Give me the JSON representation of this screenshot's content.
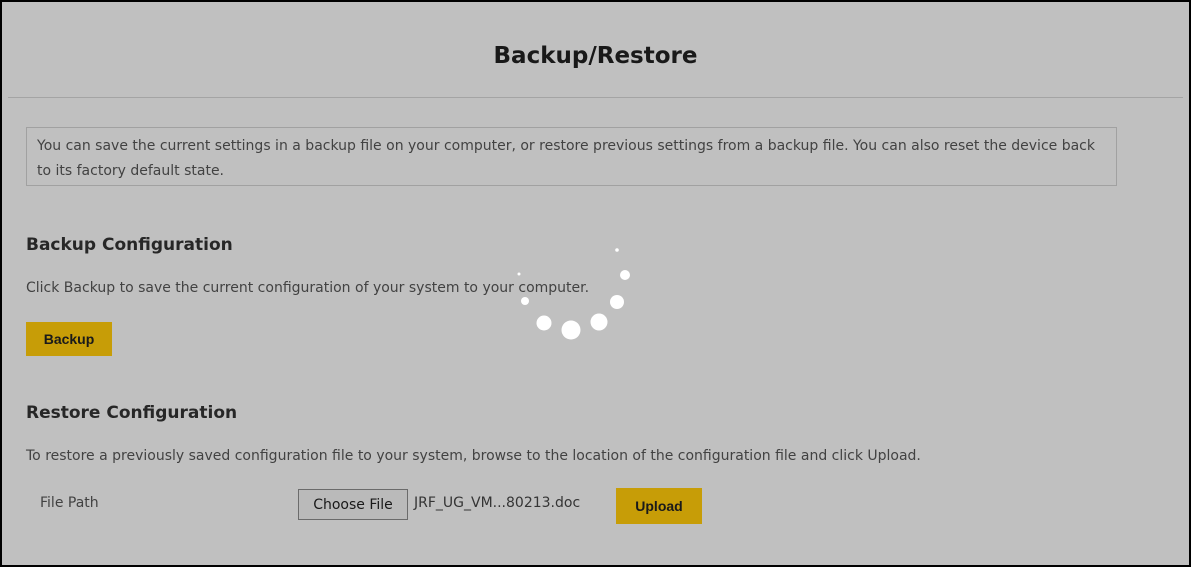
{
  "page": {
    "title": "Backup/Restore",
    "description": "You can save the current settings in a backup file on your computer, or restore previous settings from a backup file. You can also reset the device back to its factory default state."
  },
  "backup": {
    "heading": "Backup Configuration",
    "text": "Click Backup to save the current configuration of your system to your computer.",
    "button_label": "Backup"
  },
  "restore": {
    "heading": "Restore Configuration",
    "text": "To restore a previously saved configuration file to your system, browse to the location of the configuration file and click Upload.",
    "file_path_label": "File Path",
    "choose_file_label": "Choose File",
    "file_name": "JRF_UG_VM...80213.doc",
    "upload_label": "Upload"
  },
  "loading": {
    "icon": "loading-spinner-icon",
    "state": "loading"
  },
  "colors": {
    "accent": "#ffc90a",
    "overlay": "#000000"
  }
}
